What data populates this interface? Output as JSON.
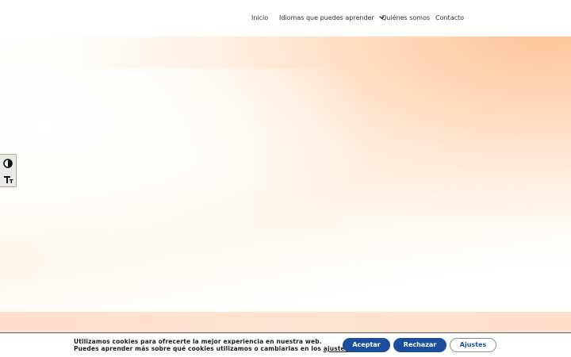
{
  "nav": {
    "items": [
      {
        "label": "Inicio"
      },
      {
        "label": "Idiomas que puedes aprender",
        "has_dropdown": true
      },
      {
        "label": "Quiénes somos"
      },
      {
        "label": "Contacto"
      }
    ]
  },
  "accessibility": {
    "contrast_icon": "contrast-icon",
    "font_size_icon": "text-size-icon"
  },
  "cookie_banner": {
    "line1": "Utilizamos cookies para ofrecerte la mejor experiencia en nuestra web.",
    "line2_prefix": "Puedes aprender más sobre qué cookies utilizamos o cambiarlas en los ",
    "line2_link": "ajustes",
    "line2_suffix": ".",
    "accept_label": "Aceptar",
    "reject_label": "Rechazar",
    "settings_label": "Ajustes"
  },
  "colors": {
    "accent": "#1c4e9e",
    "hero_peach": "#fdc496",
    "band": "#fde0cb"
  }
}
